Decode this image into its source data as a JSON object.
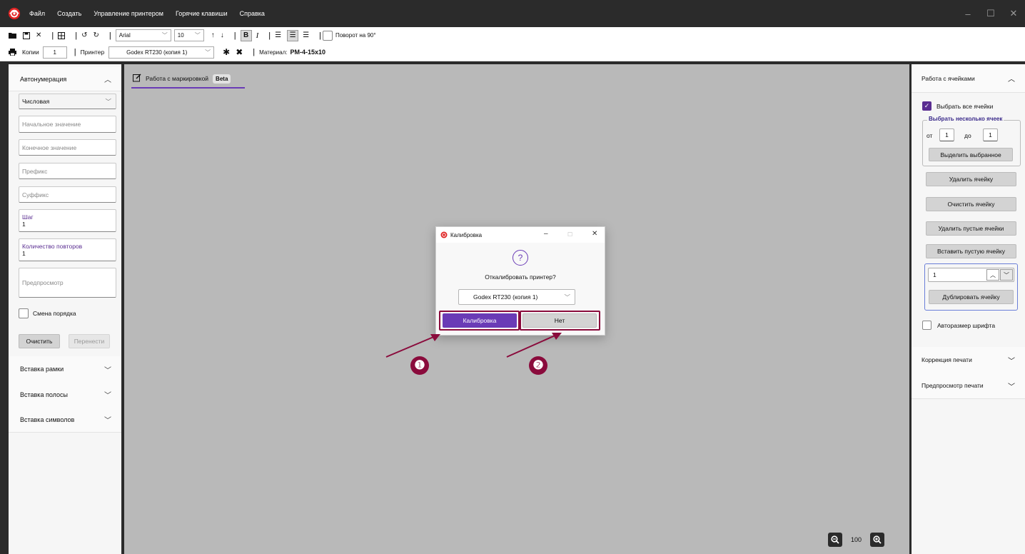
{
  "menu": {
    "items": [
      "Файл",
      "Создать",
      "Управление принтером",
      "Горячие клавиши",
      "Справка"
    ],
    "win_minimize": "–",
    "win_maximize": "☐",
    "win_close": "✕"
  },
  "toolbar": {
    "font_family": "Arial",
    "font_size": "10",
    "rotate_label": "Поворот на 90°",
    "copies_label": "Копии",
    "copies_value": "1",
    "printer_label": "Принтер",
    "printer_value": "Godex RT230 (копия 1)",
    "material_label": "Материал:",
    "material_value": "PM-4-15x10"
  },
  "left_panel": {
    "autonumbering_title": "Автонумерация",
    "type_value": "Числовая",
    "start_placeholder": "Начальное значение",
    "end_placeholder": "Конечное значение",
    "prefix_placeholder": "Префикс",
    "suffix_placeholder": "Суффикс",
    "step_label": "Шаг",
    "step_value": "1",
    "repeat_label": "Количество повторов",
    "repeat_value": "1",
    "preview_placeholder": "Предпросмотр",
    "reverse_order_label": "Смена порядка",
    "clear_button": "Очистить",
    "transfer_button": "Перенести",
    "sections": [
      "Вставка рамки",
      "Вставка полосы",
      "Вставка символов"
    ]
  },
  "canvas": {
    "tab_label": "Работа с маркировкой",
    "tab_badge": "Beta",
    "zoom_value": "100"
  },
  "dialog": {
    "title": "Калибровка",
    "question_icon": "?",
    "question": "Откалибровать принтер?",
    "printer_value": "Godex RT230 (копия 1)",
    "calibrate_button": "Калибровка",
    "no_button": "Нет"
  },
  "annotations": {
    "badge_1": "❶",
    "badge_2": "❷",
    "color": "#8a0b3c"
  },
  "right_panel": {
    "cells_title": "Работа с ячейками",
    "select_all_label": "Выбрать все ячейки",
    "select_multiple_title": "Выбрать несколько ячеек",
    "from_label": "от",
    "from_value": "1",
    "to_label": "до",
    "to_value": "1",
    "highlight_button": "Выделить выбранное",
    "delete_cell_button": "Удалить ячейку",
    "clear_cell_button": "Очистить ячейку",
    "delete_empty_button": "Удалить пустые ячейки",
    "insert_empty_button": "Вставить пустую ячейку",
    "duplicate_count": "1",
    "duplicate_button": "Дублировать ячейку",
    "autosize_label": "Авторазмер шрифта",
    "print_correction_title": "Коррекция печати",
    "print_preview_title": "Предпросмотр печати"
  },
  "colors": {
    "accent": "#6a3bb6",
    "dark_frame": "#2b2b2b",
    "canvas_bg": "#b9b9b9",
    "annotation": "#8a0b3c"
  }
}
